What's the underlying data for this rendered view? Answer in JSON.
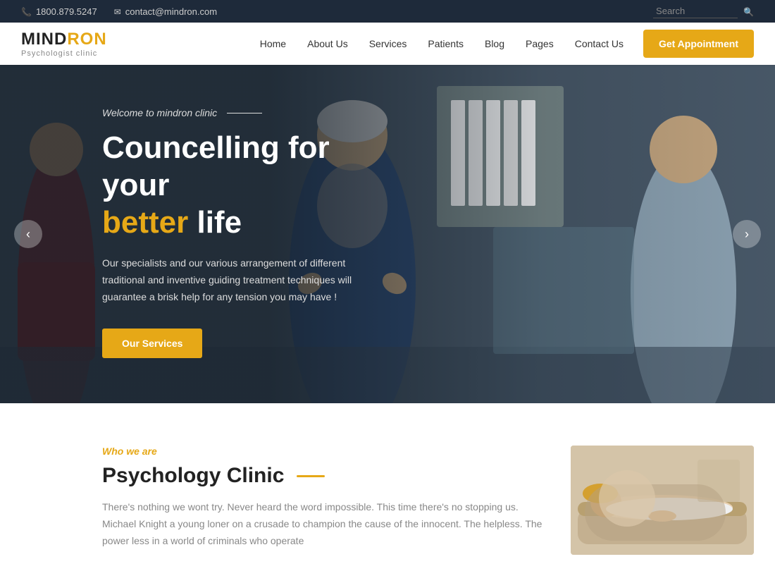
{
  "topbar": {
    "phone": "1800.879.5247",
    "email": "contact@mindron.com",
    "search_placeholder": "Search"
  },
  "header": {
    "logo_mind": "MIND",
    "logo_ron": "RON",
    "logo_sub": "Psychologist clinic",
    "nav": [
      {
        "label": "Home",
        "id": "home"
      },
      {
        "label": "About Us",
        "id": "about"
      },
      {
        "label": "Services",
        "id": "services"
      },
      {
        "label": "Patients",
        "id": "patients"
      },
      {
        "label": "Blog",
        "id": "blog"
      },
      {
        "label": "Pages",
        "id": "pages"
      },
      {
        "label": "Contact Us",
        "id": "contact"
      }
    ],
    "appointment_btn": "Get Appointment"
  },
  "hero": {
    "welcome": "Welcome to mindron clinic",
    "title_line1": "Councelling for your",
    "title_highlight": "better",
    "title_line2": " life",
    "description": "Our specialists and our various arrangement of different traditional and inventive guiding treatment techniques will guarantee a brisk help for any tension you may have !",
    "cta_btn": "Our Services",
    "arrow_left": "‹",
    "arrow_right": "›"
  },
  "about": {
    "label": "Who we are",
    "title": "Psychology Clinic",
    "description": "There's nothing we wont try. Never heard the word impossible. This time there's no stopping us. Michael Knight a young loner on a crusade to champion the cause of the innocent. The helpless. The power less in a world of criminals who operate"
  }
}
